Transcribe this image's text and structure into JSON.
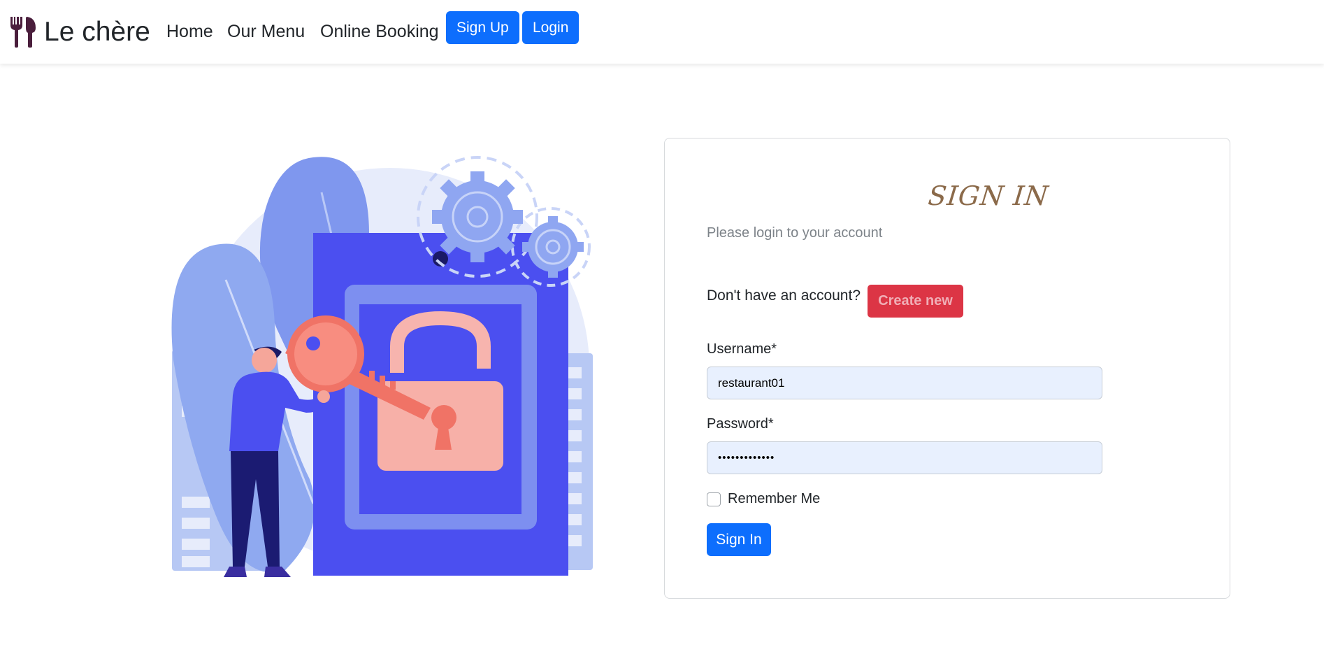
{
  "navbar": {
    "brand_icon": "fork-spoon-icon",
    "brand": "Le chère",
    "links": [
      "Home",
      "Our Menu",
      "Online Booking"
    ],
    "signup_label": "Sign Up",
    "login_label": "Login"
  },
  "illustration": {
    "icon": "unlock-with-key-illustration"
  },
  "signin_card": {
    "title": "SIGN IN",
    "subtitle": "Please login to your account",
    "no_account_text": "Don't have an account?",
    "create_new_label": "Create new",
    "username_label": "Username*",
    "username_value": "restaurant01",
    "password_label": "Password*",
    "password_value": "•••••••••••••",
    "remember_label": "Remember Me",
    "remember_checked": false,
    "signin_label": "Sign In"
  },
  "colors": {
    "primary": "#0d6efd",
    "danger": "#dc3545",
    "title_brown": "#8b6a4a",
    "input_bg": "#e8f0fe"
  }
}
